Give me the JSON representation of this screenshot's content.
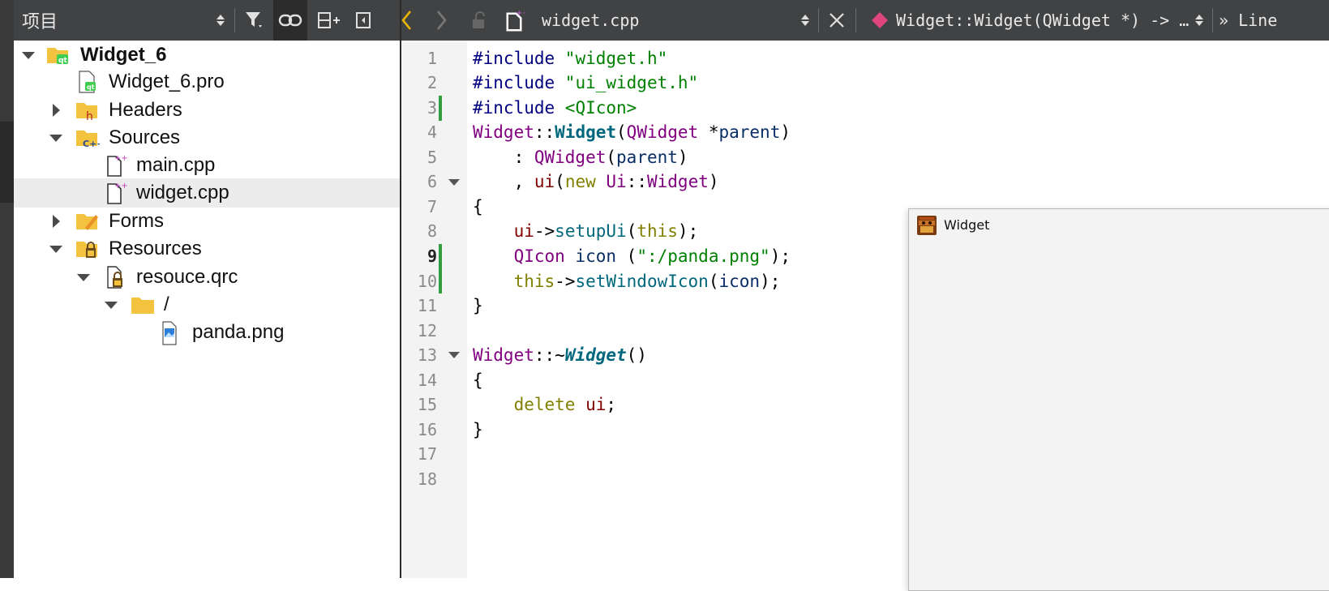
{
  "project_panel": {
    "title": "项目",
    "tree": [
      {
        "label": "Widget_6",
        "bold": true
      },
      {
        "label": "Widget_6.pro"
      },
      {
        "label": "Headers"
      },
      {
        "label": "Sources"
      },
      {
        "label": "main.cpp"
      },
      {
        "label": "widget.cpp"
      },
      {
        "label": "Forms"
      },
      {
        "label": "Resources"
      },
      {
        "label": "resouce.qrc"
      },
      {
        "label": "/"
      },
      {
        "label": "panda.png"
      }
    ]
  },
  "editor_toolbar": {
    "filename": "widget.cpp",
    "symbol": "Widget::Widget(QWidget *) -> …",
    "line_label": "» Line"
  },
  "editor": {
    "line_numbers": [
      "1",
      "2",
      "3",
      "4",
      "5",
      "6",
      "7",
      "8",
      "9",
      "10",
      "11",
      "12",
      "13",
      "14",
      "15",
      "16",
      "17",
      "18"
    ],
    "current_line": "9"
  },
  "widget_window": {
    "title": "Widget"
  },
  "colors": {
    "toolbar_bg": "#404244",
    "change_marker": "#2e9e3e",
    "keyword": "#808000",
    "string": "#008000",
    "type": "#800080",
    "function": "#00677c"
  }
}
